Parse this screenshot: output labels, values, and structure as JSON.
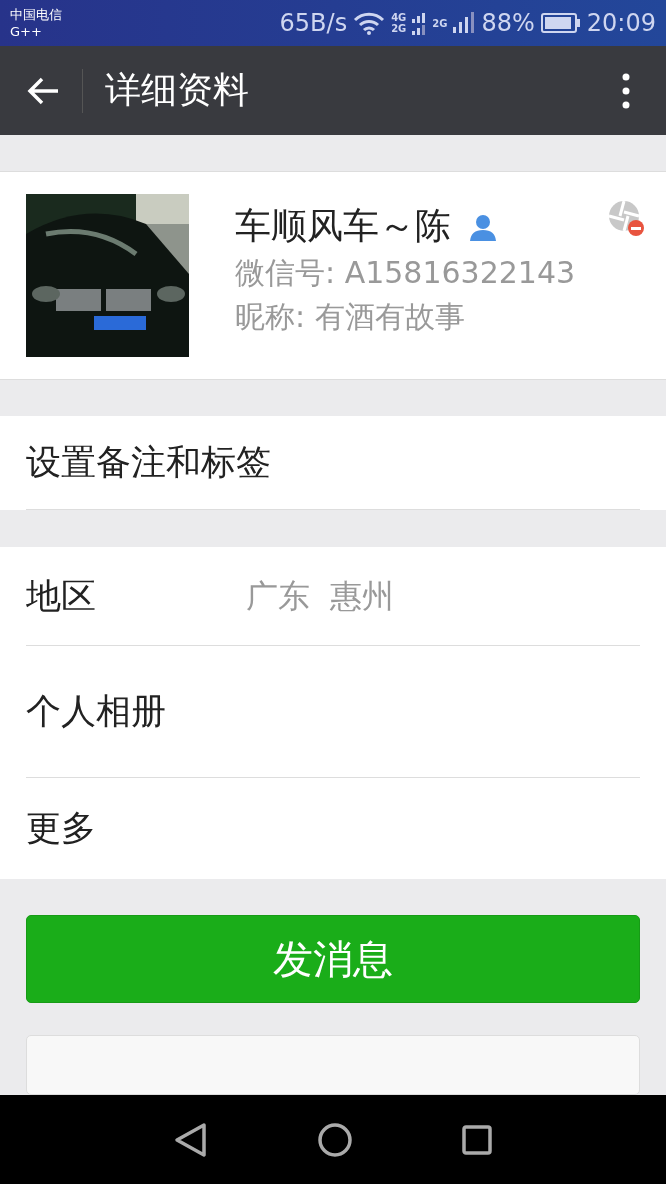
{
  "status_bar": {
    "carrier": "中国电信",
    "network": "G++",
    "speed": "65B/s",
    "sim1_label_top": "4G",
    "sim1_label_bottom": "2G",
    "sim2_label": "2G",
    "battery": "88%",
    "time": "20:09"
  },
  "toolbar": {
    "title": "详细资料"
  },
  "profile": {
    "name": "车顺风车～陈",
    "wechat_id": "微信号: A15816322143",
    "nickname": "昵称: 有酒有故事"
  },
  "remark": {
    "label": "设置备注和标签"
  },
  "info_rows": [
    {
      "label": "地区",
      "value": "广东  惠州"
    },
    {
      "label": "个人相册"
    },
    {
      "label": "更多"
    }
  ],
  "primary_button": {
    "label": "发消息"
  },
  "secondary_button": {
    "kind": "cut"
  }
}
